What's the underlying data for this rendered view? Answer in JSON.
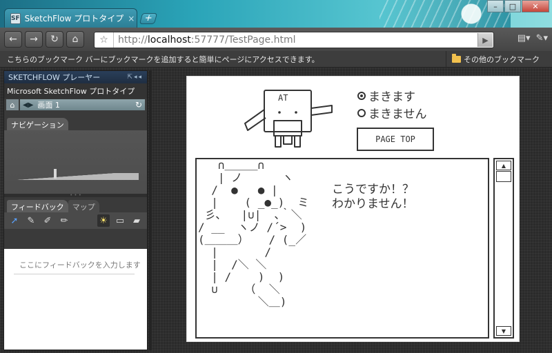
{
  "browser": {
    "tab_title": "SketchFlow プロトタイプ",
    "tab_icon": "sketchflow-favicon",
    "tab_close": "×",
    "new_tab": "+",
    "url_scheme": "http://",
    "url_host": "localhost",
    "url_rest": ":57777/TestPage.html",
    "bookmark_message": "こちらのブックマーク バーにブックマークを追加すると簡単にページにアクセスできます。",
    "other_bookmarks": "その他のブックマーク",
    "win_min": "–",
    "win_max": "□",
    "win_close": "✕"
  },
  "player": {
    "header_title": "SKETCHFLOW プレーヤー",
    "project_name": "Microsoft SketchFlow プロトタイプ",
    "current_screen": "画面 1",
    "nav_tab": "ナビゲーション",
    "feedback_tab": "フィードバック",
    "map_tab": "マップ",
    "feedback_placeholder": "ここにフィードバックを入力します"
  },
  "sketch": {
    "robot_label": "AT",
    "radio_options": [
      {
        "label": "まきます",
        "selected": true
      },
      {
        "label": "まきません",
        "selected": false
      }
    ],
    "page_top_button": "PAGE TOP",
    "speech_line1": "こうですか！？",
    "speech_line2": "わかりません！",
    "ascii_art": "   ∩＿＿＿∩\n   | ノ      ヽ\n  /  ●   ● |\n  |    ( _●_)  ミ\n 彡､   |∪|  ､｀＼\n/ __  ヽノ /´>  )\n(＿＿＿）   / (_／\n  |       /\n  |  /＼ ＼\n  | /    )  )\n  ∪    （  ＼\n         ＼＿)",
    "scroll_up": "▲",
    "scroll_down": "▼"
  }
}
